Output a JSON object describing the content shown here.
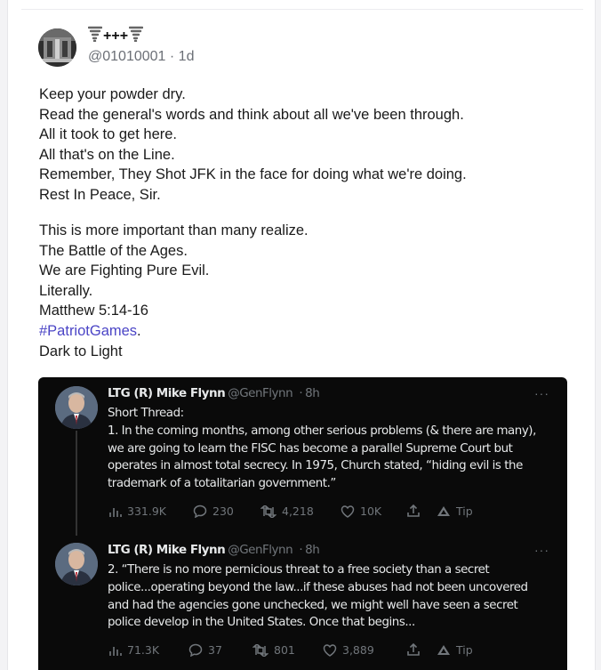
{
  "post": {
    "display_name": "+++",
    "display_name_icon": "tornado-icon",
    "handle": "@01010001",
    "separator": "·",
    "age": "1d",
    "paragraph1": [
      "Keep your powder dry.",
      "Read the general's words and think about all we've been through.",
      "All it took to get here.",
      "All that's on the Line.",
      "Remember, They Shot JFK in the face for doing what we're doing.",
      "Rest In Peace, Sir."
    ],
    "paragraph2_lines": [
      "This is more important than many realize.",
      "The Battle of the Ages.",
      "We are Fighting Pure Evil.",
      "Literally.",
      "Matthew 5:14-16"
    ],
    "hashtag": "#PatriotGames",
    "hashtag_suffix": ".",
    "last_line": "Dark to Light"
  },
  "embed": {
    "tweets": [
      {
        "name": "LTG (R) Mike Flynn",
        "handle": "@GenFlynn",
        "separator": "·",
        "age": "8h",
        "more": "···",
        "lines": [
          "Short Thread:",
          "1. In the coming months, among other serious problems (& there are many),",
          "we are going to learn the FISC has become a parallel Supreme Court but",
          "operates in almost total secrecy. In 1975, Church stated, “hiding evil is the",
          "trademark of a totalitarian government.”"
        ],
        "views": "331.9K",
        "replies": "230",
        "retweets": "4,218",
        "likes": "10K",
        "tip": "Tip"
      },
      {
        "name": "LTG (R) Mike Flynn",
        "handle": "@GenFlynn",
        "separator": "·",
        "age": "8h",
        "more": "···",
        "lines": [
          "2. “There is no more pernicious threat to a free society than a secret",
          "police...operating beyond the law...if these abuses had not been uncovered",
          "and had the agencies gone unchecked, we might well have seen a secret",
          "police develop in the United States. Once that begins..."
        ],
        "views": "71.3K",
        "replies": "37",
        "retweets": "801",
        "likes": "3,889",
        "tip": "Tip"
      }
    ]
  },
  "colors": {
    "hashtag": "#4b45c6",
    "embed_bg": "#0a0a0a",
    "embed_text": "#e7e9ea",
    "embed_muted": "#71767b"
  }
}
